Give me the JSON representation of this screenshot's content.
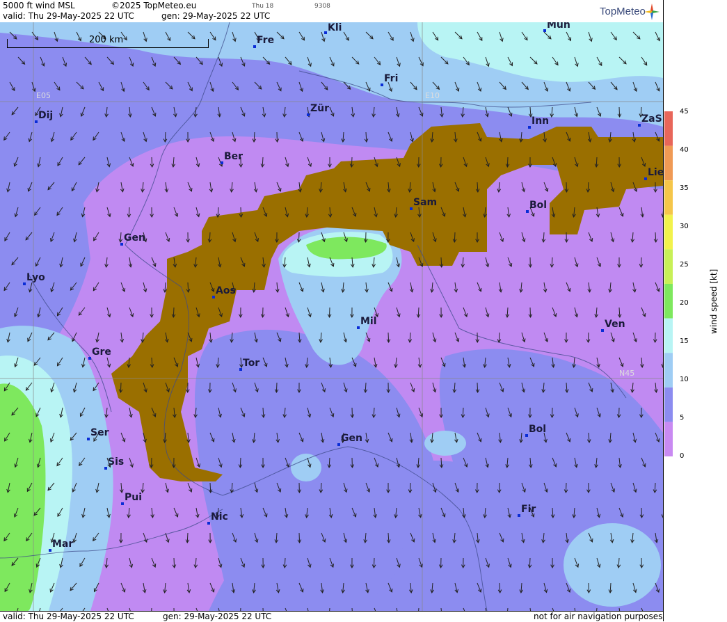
{
  "header": {
    "line1_left": "5000 ft wind MSL",
    "copyright": "©2025 TopMeteo.eu",
    "day_tag": "Thu 18",
    "code_tag": "9308",
    "line2_valid": "valid:  Thu   29-May-2025  22 UTC",
    "line2_gen": "gen: 29-May-2025 22 UTC",
    "logo_text": "TopMeteo"
  },
  "scale_bar": {
    "label": "200 km"
  },
  "grid_labels": {
    "lon1": "E05",
    "lon2": "E10",
    "lat1": "N45"
  },
  "cities": [
    {
      "name": "Kli"
    },
    {
      "name": "Mün"
    },
    {
      "name": "Fre"
    },
    {
      "name": "Fri"
    },
    {
      "name": "Dij"
    },
    {
      "name": "Zür"
    },
    {
      "name": "Inn"
    },
    {
      "name": "ZaS"
    },
    {
      "name": "Ber"
    },
    {
      "name": "Lie"
    },
    {
      "name": "Sam"
    },
    {
      "name": "Bol"
    },
    {
      "name": "Gen"
    },
    {
      "name": "Lyo"
    },
    {
      "name": "Aos"
    },
    {
      "name": "Mil"
    },
    {
      "name": "Ven"
    },
    {
      "name": "Gre"
    },
    {
      "name": "Tor"
    },
    {
      "name": "Ser"
    },
    {
      "name": "Gen"
    },
    {
      "name": "Bol"
    },
    {
      "name": "Sis"
    },
    {
      "name": "Pui"
    },
    {
      "name": "Nic"
    },
    {
      "name": "Fir"
    },
    {
      "name": "Mar"
    }
  ],
  "colorbar": {
    "title": "wind speed  [kt]",
    "ticks": [
      "45",
      "40",
      "35",
      "30",
      "25",
      "20",
      "15",
      "10",
      "5",
      "0"
    ],
    "colors": [
      "#e8665a",
      "#f09a55",
      "#f5c64a",
      "#f2f24c",
      "#c8f057",
      "#7ee85e",
      "#b8f4f4",
      "#9fcdf4",
      "#8c8cf0",
      "#c98af2"
    ]
  },
  "footer": {
    "valid": "valid:  Thu   29-May-2025   22 UTC",
    "gen": "gen: 29-May-2025 22 UTC",
    "disclaimer": "not for air navigation purposes"
  },
  "colors": {
    "terrain": "#9a6f00",
    "calm": "#c98af2",
    "light": "#8c8cf0",
    "moderate": "#9fcdf4",
    "fresh": "#b8f4f4",
    "strong": "#7ee85e"
  }
}
